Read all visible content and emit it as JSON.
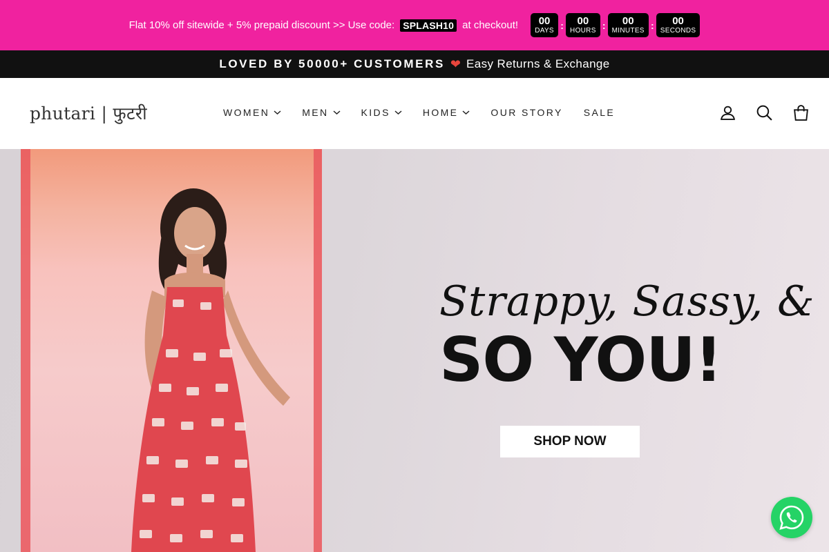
{
  "promo": {
    "text_before": "Flat 10% off sitewide + 5% prepaid discount >> Use code:",
    "code": "SPLASH10",
    "text_after": "at checkout!",
    "countdown": [
      {
        "value": "00",
        "label": "DAYS"
      },
      {
        "value": "00",
        "label": "HOURS"
      },
      {
        "value": "00",
        "label": "MINUTES"
      },
      {
        "value": "00",
        "label": "SECONDS"
      }
    ],
    "separator": ":",
    "bg_color": "#f0229f"
  },
  "announcement": {
    "strong": "LOVED BY 50000+ CUSTOMERS",
    "heart": "❤",
    "soft": "Easy Returns & Exchange"
  },
  "header": {
    "logo": "phutari | फुटरी",
    "nav": [
      {
        "label": "WOMEN",
        "has_dropdown": true
      },
      {
        "label": "MEN",
        "has_dropdown": true
      },
      {
        "label": "KIDS",
        "has_dropdown": true
      },
      {
        "label": "HOME",
        "has_dropdown": true
      },
      {
        "label": "OUR STORY",
        "has_dropdown": false
      },
      {
        "label": "SALE",
        "has_dropdown": false
      }
    ],
    "icons": [
      "account-icon",
      "search-icon",
      "cart-icon"
    ]
  },
  "hero": {
    "script_line": "Strappy, Sassy, &",
    "bold_line": "SO YOU!",
    "button": "SHOP NOW"
  },
  "whatsapp": {
    "icon": "whatsapp-icon",
    "color": "#25d366"
  }
}
